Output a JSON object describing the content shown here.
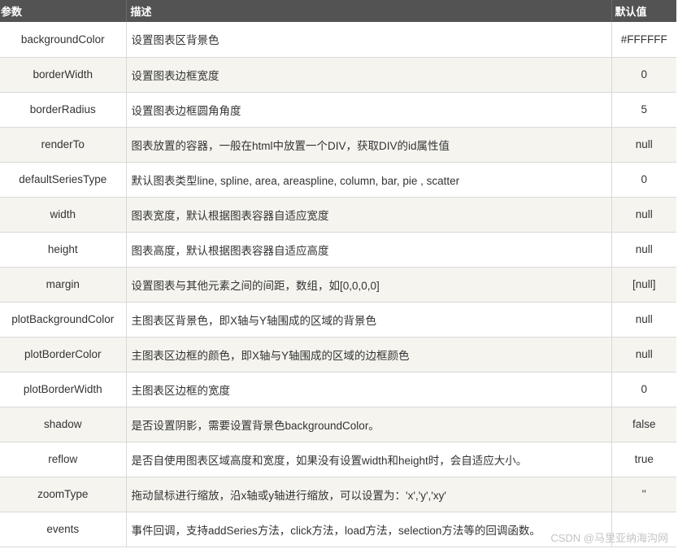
{
  "headers": {
    "param": "参数",
    "desc": "描述",
    "default": "默认值"
  },
  "rows": [
    {
      "param": "backgroundColor",
      "desc": "设置图表区背景色",
      "default": "#FFFFFF"
    },
    {
      "param": "borderWidth",
      "desc": "设置图表边框宽度",
      "default": "0"
    },
    {
      "param": "borderRadius",
      "desc": "设置图表边框圆角角度",
      "default": "5"
    },
    {
      "param": "renderTo",
      "desc": "图表放置的容器，一般在html中放置一个DIV，获取DIV的id属性值",
      "default": "null"
    },
    {
      "param": "defaultSeriesType",
      "desc": "默认图表类型line, spline, area, areaspline, column, bar, pie , scatter",
      "default": "0"
    },
    {
      "param": "width",
      "desc": "图表宽度，默认根据图表容器自适应宽度",
      "default": "null"
    },
    {
      "param": "height",
      "desc": "图表高度，默认根据图表容器自适应高度",
      "default": "null"
    },
    {
      "param": "margin",
      "desc": "设置图表与其他元素之间的间距，数组，如[0,0,0,0]",
      "default": "[null]"
    },
    {
      "param": "plotBackgroundColor",
      "desc": "主图表区背景色，即X轴与Y轴围成的区域的背景色",
      "default": "null"
    },
    {
      "param": "plotBorderColor",
      "desc": "主图表区边框的颜色，即X轴与Y轴围成的区域的边框颜色",
      "default": "null"
    },
    {
      "param": "plotBorderWidth",
      "desc": "主图表区边框的宽度",
      "default": "0"
    },
    {
      "param": "shadow",
      "desc": "是否设置阴影，需要设置背景色backgroundColor。",
      "default": "false"
    },
    {
      "param": "reflow",
      "desc": "是否自使用图表区域高度和宽度，如果没有设置width和height时，会自适应大小。",
      "default": "true"
    },
    {
      "param": "zoomType",
      "desc": "拖动鼠标进行缩放，沿x轴或y轴进行缩放，可以设置为：'x','y','xy'",
      "default": "''"
    },
    {
      "param": "events",
      "desc": "事件回调，支持addSeries方法，click方法，load方法，selection方法等的回调函数。",
      "default": ""
    }
  ],
  "watermark": "CSDN @马里亚纳海沟网",
  "colors": {
    "header_bg": "#535353",
    "header_text": "#ffffff",
    "row_alt_bg": "#f5f4ef",
    "row_bg": "#ffffff",
    "border": "#d9d9d9",
    "text": "#333333"
  }
}
